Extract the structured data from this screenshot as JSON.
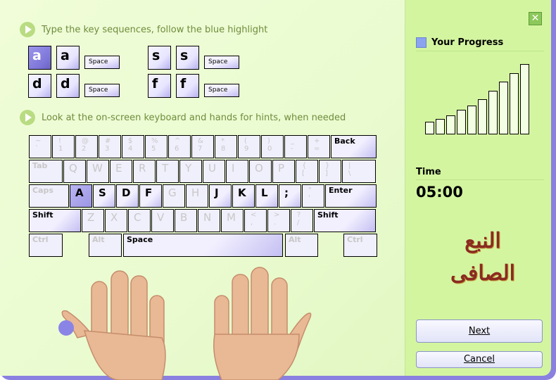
{
  "instructions": {
    "first": "Type the key sequences, follow the blue highlight",
    "second": "Look at the on-screen keyboard and hands for hints, when needed"
  },
  "sequences": [
    {
      "keys": [
        "a",
        "a"
      ],
      "space": "Space",
      "highlighted": 0
    },
    {
      "keys": [
        "s",
        "s"
      ],
      "space": "Space"
    },
    {
      "keys": [
        "d",
        "d"
      ],
      "space": "Space"
    },
    {
      "keys": [
        "f",
        "f"
      ],
      "space": "Space"
    }
  ],
  "keyboard": {
    "rows": [
      [
        "~\n`",
        "!\n1",
        "@\n2",
        "#\n3",
        "$\n4",
        "%\n5",
        "^\n6",
        "&\n7",
        "*\n8",
        "(\n9",
        ")\n0",
        "_\n-",
        "+\n=",
        "Back"
      ],
      [
        "Tab",
        "Q",
        "W",
        "E",
        "R",
        "T",
        "Y",
        "U",
        "I",
        "O",
        "P",
        "{\n[",
        "}\n]",
        "|\n\\"
      ],
      [
        "Caps",
        "A",
        "S",
        "D",
        "F",
        "G",
        "H",
        "J",
        "K",
        "L",
        ";",
        "\"\n'",
        "Enter"
      ],
      [
        "Shift",
        "Z",
        "X",
        "C",
        "V",
        "B",
        "N",
        "M",
        "<\n,",
        ">\n.",
        "?\n/",
        "Shift"
      ],
      [
        "Ctrl",
        "Alt",
        "Space",
        "Alt",
        "Ctrl"
      ]
    ],
    "active_keys": [
      "A",
      "S",
      "D",
      "F",
      "J",
      "K",
      "L",
      ";",
      "Back",
      "Enter",
      "Shift",
      "Space"
    ],
    "highlighted_key": "A"
  },
  "sidebar": {
    "close_icon": "close-icon",
    "progress_title": "Your Progress",
    "progress_bars": [
      17,
      21,
      26,
      34,
      40,
      49,
      61,
      74,
      86,
      99
    ],
    "time_label": "Time",
    "time_value": "05:00",
    "logo_text": [
      "النبع",
      "الصافى"
    ],
    "next_label": "Next",
    "cancel_label": "Cancel"
  },
  "colors": {
    "highlight": "#8a84e6",
    "sidebar": "#d4f5a0",
    "accent": "#8a80e0"
  }
}
